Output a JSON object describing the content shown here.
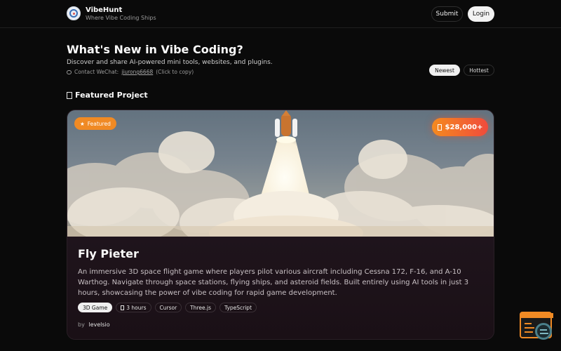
{
  "header": {
    "brand": "VibeHunt",
    "tagline": "Where Vibe Coding Ships",
    "submit_label": "Submit",
    "login_label": "Login"
  },
  "hero": {
    "title": "What's New in Vibe Coding?",
    "description": "Discover and share AI-powered mini tools, websites, and plugins.",
    "contact_prefix": "Contact WeChat:",
    "wechat_id": "jiurong6668",
    "copy_hint": "(Click to copy)"
  },
  "sort": {
    "newest_label": "Newest",
    "hottest_label": "Hottest",
    "active": "Newest"
  },
  "featured_section": {
    "heading": "Featured Project"
  },
  "project": {
    "badge": "Featured",
    "price": "$28,000+",
    "title": "Fly Pieter",
    "description": "An immersive 3D space flight game where players pilot various aircraft including Cessna 172, F-16, and A-10 Warthog. Navigate through space stations, flying ships, and asteroid fields. Built entirely using AI tools in just 3 hours, showcasing the power of vibe coding for rapid game development.",
    "tags": [
      "3D Game",
      "3 hours",
      "Cursor",
      "Three.js",
      "TypeScript"
    ],
    "by_label": "by",
    "author": "levelsio"
  },
  "colors": {
    "accent": "#f08a24",
    "background": "#0a0a0a"
  }
}
